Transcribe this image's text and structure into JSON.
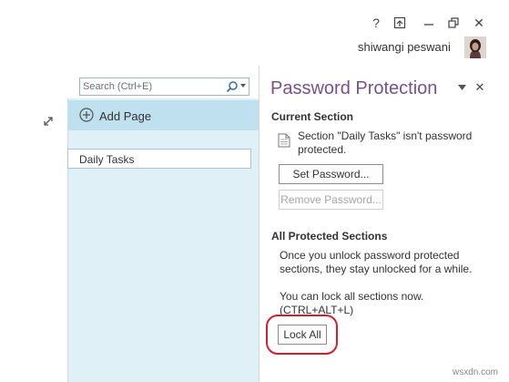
{
  "titlebar": {
    "help_label": "?",
    "restore_ribbon_label": "⊼",
    "restore_label": "❐",
    "close_label": "✕",
    "username": "shiwangi peswani"
  },
  "search": {
    "placeholder": "Search (Ctrl+E)"
  },
  "pages": {
    "add_page_label": "Add Page",
    "items": [
      {
        "label": "Daily Tasks"
      }
    ]
  },
  "pane": {
    "title": "Password Protection",
    "close_label": "✕",
    "current_section": {
      "heading": "Current Section",
      "status_line1": "Section \"Daily Tasks\" isn't password",
      "status_line2": "protected.",
      "set_password_label": "Set Password...",
      "remove_password_label": "Remove Password..."
    },
    "all_sections": {
      "heading": "All Protected Sections",
      "info_line1": "Once you unlock password protected",
      "info_line2": "sections, they stay unlocked for a while.",
      "lock_line1": "You can lock all sections now.",
      "lock_line2": "(CTRL+ALT+L)",
      "lock_all_label": "Lock All"
    }
  },
  "watermark": "wsxdn.com",
  "colors": {
    "accent": "#7a4f92",
    "page_strip": "#dff0f7",
    "add_page_bar": "#bfe0ee",
    "highlight": "#d21f2d"
  }
}
